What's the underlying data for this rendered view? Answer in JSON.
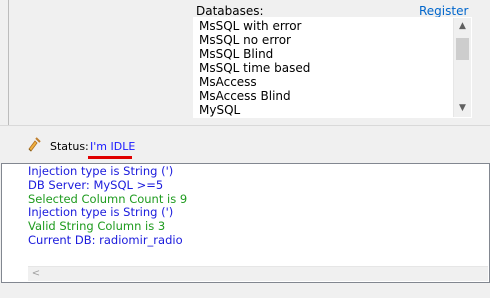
{
  "databases": {
    "label": "Databases:",
    "register_label": "Register",
    "items": [
      "MsSQL with error",
      "MsSQL no error",
      "MsSQL Blind",
      "MsSQL time based",
      "MsAccess",
      "MsAccess Blind",
      "MySQL"
    ]
  },
  "status": {
    "label": "Status:",
    "value": "I'm IDLE",
    "icon": "broom-icon"
  },
  "console": {
    "lines": [
      {
        "text": "Injection type is String (')",
        "color": "#1a1adc"
      },
      {
        "text": "DB Server: MySQL >=5",
        "color": "#1a1adc"
      },
      {
        "text": "Selected Column Count is 9",
        "color": "#1f9b1f"
      },
      {
        "text": "Injection type is String (')",
        "color": "#1a1adc"
      },
      {
        "text": "Valid String Column is 3",
        "color": "#1f9b1f"
      },
      {
        "text": "Current DB: radiomir_radio",
        "color": "#1a1adc"
      }
    ]
  },
  "colors": {
    "status_underline": "#e00000",
    "link": "#0066cc"
  }
}
